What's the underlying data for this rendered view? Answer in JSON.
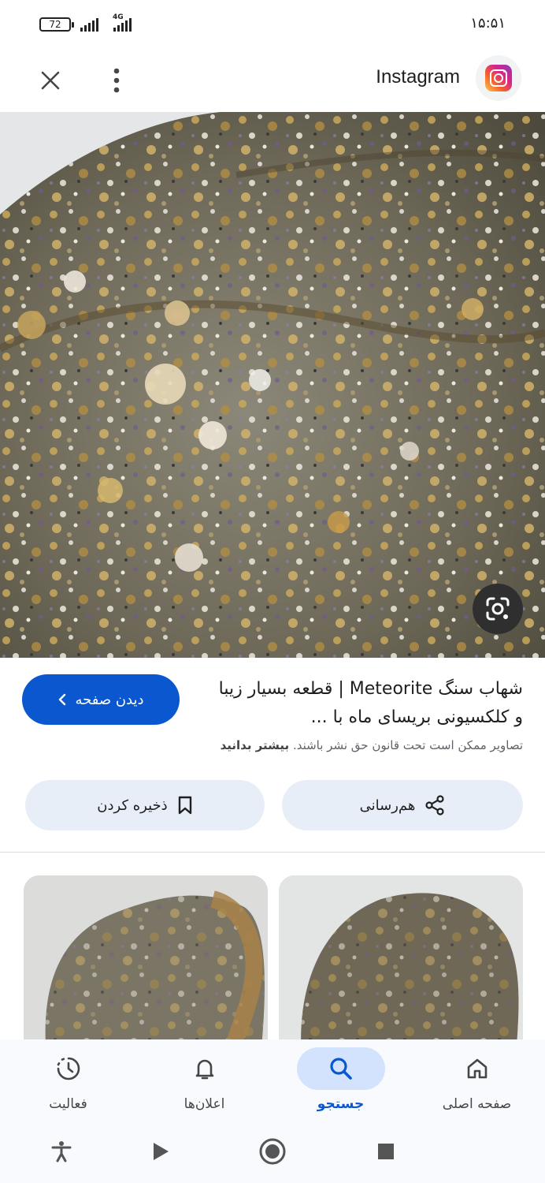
{
  "status_bar": {
    "battery": "72",
    "network": "4G",
    "time": "۱۵:۵۱"
  },
  "header": {
    "site_name": "Instagram"
  },
  "result": {
    "title": "شهاب سنگ Meteorite | قطعه بسیار زیبا و کلکسیونی بریسای ماه با ...",
    "visit_label": "دیدن صفحه",
    "copyright_text": "تصاویر ممکن است تحت قانون حق نشر باشند.",
    "learn_more": "بیشتر بدانید",
    "share_label": "هم‌رسانی",
    "save_label": "ذخیره کردن"
  },
  "bottom_nav": {
    "items": [
      {
        "label": "صفحه اصلی",
        "icon": "home-icon"
      },
      {
        "label": "جستجو",
        "icon": "search-icon",
        "active": true
      },
      {
        "label": "اعلان‌ها",
        "icon": "bell-icon"
      },
      {
        "label": "فعالیت",
        "icon": "activity-icon"
      }
    ]
  },
  "colors": {
    "accent": "#0b57d0",
    "action_button_bg": "#e8eef8",
    "nav_active_bg": "#d3e3fd"
  }
}
